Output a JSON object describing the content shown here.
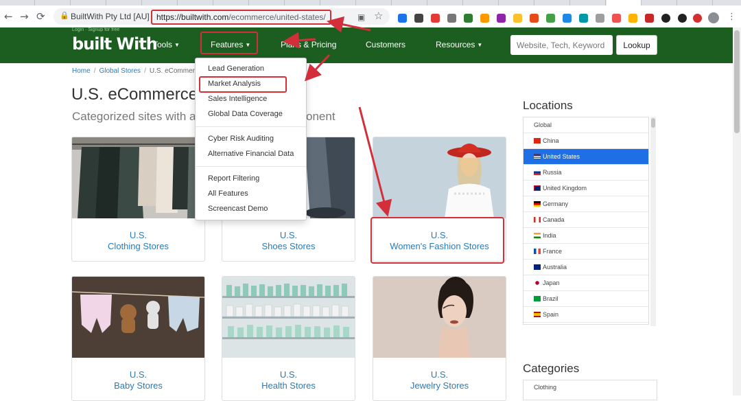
{
  "browser": {
    "back_icon": "←",
    "forward_icon": "→",
    "reload_icon": "⟳",
    "site_name": "BuiltWith Pty Ltd [AU]",
    "url_host": "https://builtwith.com",
    "url_path": "/ecommerce/united-states/",
    "translate_icon": "▣",
    "star_icon": "☆",
    "menu_icon": "⋮"
  },
  "nav": {
    "logo": "built With",
    "logo_tagline": "Login · Signup for free",
    "tools": "Tools",
    "features": "Features",
    "plans": "Plans & Pricing",
    "customers": "Customers",
    "resources": "Resources",
    "search_placeholder": "Website, Tech, Keyword",
    "lookup": "Lookup"
  },
  "breadcrumb": {
    "home": "Home",
    "global": "Global Stores",
    "current": "U.S. eCommerce"
  },
  "page": {
    "title": "U.S. eCommerce",
    "subtitle": "Categorized sites with a",
    "subtitle_tail": "onent"
  },
  "features_menu": {
    "items1": [
      "Lead Generation",
      "Market Analysis",
      "Sales Intelligence",
      "Global Data Coverage"
    ],
    "items2": [
      "Cyber Risk Auditing",
      "Alternative Financial Data"
    ],
    "items3": [
      "Report Filtering",
      "All Features",
      "Screencast Demo"
    ]
  },
  "cards": [
    {
      "line1": "U.S.",
      "line2": "Clothing Stores"
    },
    {
      "line1": "U.S.",
      "line2": "Shoes Stores"
    },
    {
      "line1": "U.S.",
      "line2": "Women's Fashion Stores"
    },
    {
      "line1": "U.S.",
      "line2": "Baby Stores"
    },
    {
      "line1": "U.S.",
      "line2": "Health Stores"
    },
    {
      "line1": "U.S.",
      "line2": "Jewelry Stores"
    }
  ],
  "sidebar": {
    "locations_title": "Locations",
    "locations": [
      "Global",
      "China",
      "United States",
      "Russia",
      "United Kingdom",
      "Germany",
      "Canada",
      "India",
      "France",
      "Australia",
      "Japan",
      "Brazil",
      "Spain"
    ],
    "active_location": "United States",
    "categories_title": "Categories",
    "first_category": "Clothing"
  },
  "colors": {
    "nav_green": "#1b5e20",
    "link_blue": "#2a7ab8",
    "active_blue": "#1e6fe6",
    "highlight_red": "#d32f3a"
  }
}
